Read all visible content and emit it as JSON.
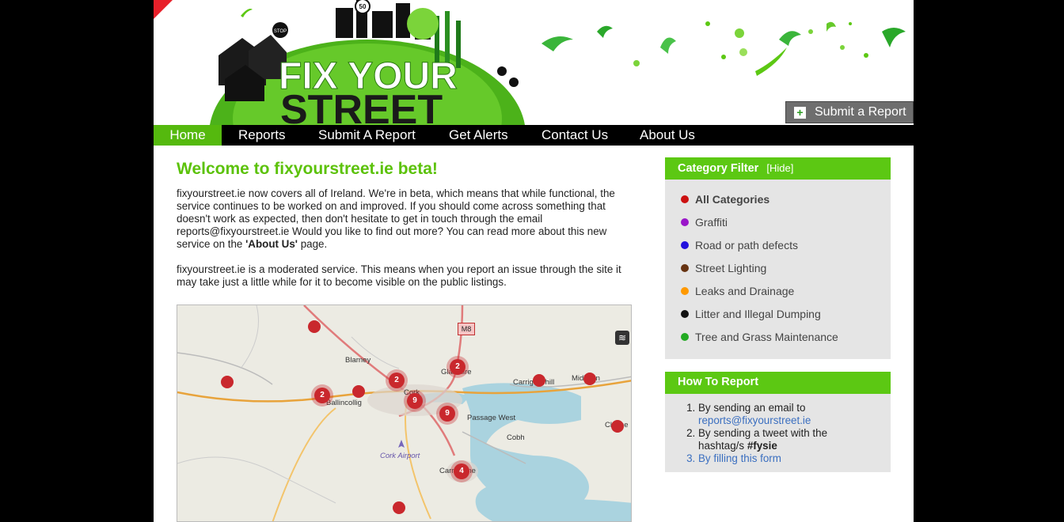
{
  "header": {
    "logo_text_line1": "FIX YOUR",
    "logo_text_line2": "STREET",
    "sign_stop": "STOP",
    "sign_speed": "50",
    "submit_report_label": "Submit a Report"
  },
  "nav": {
    "items": [
      {
        "label": "Home",
        "active": true
      },
      {
        "label": "Reports"
      },
      {
        "label": "Submit A Report"
      },
      {
        "label": "Get Alerts"
      },
      {
        "label": "Contact Us"
      },
      {
        "label": "About Us"
      }
    ]
  },
  "main": {
    "title": "Welcome to fixyourstreet.ie beta!",
    "p1_text": "fixyourstreet.ie now covers all of Ireland. We're in beta, which means that while functional, the service continues to be worked on and improved. If you should come across something that doesn't work as expected, then don't hesitate to get in touch through the email reports@fixyourstreet.ie Would you like to find out more? You can read more about this new service on the",
    "p1_bold": "'About Us'",
    "p1_end": " page.",
    "p2_text": "fixyourstreet.ie is a moderated service. This means when you report an issue through the site it may take just a little while for it to become visible on the public listings."
  },
  "map": {
    "road_sign": "M8",
    "labels": [
      "Blarney",
      "Glanmire",
      "Carrigtwohill",
      "Midleton",
      "Cork",
      "Ballincollig",
      "Passage West",
      "Cobh",
      "Cloyne",
      "Cork Airport",
      "Carrigaline"
    ],
    "clusters": [
      "2",
      "2",
      "2",
      "9",
      "9",
      "4"
    ],
    "layers_icon": "layers-icon"
  },
  "category_filter": {
    "title": "Category Filter",
    "hide_label": "[Hide]",
    "items": [
      {
        "label": "All Categories",
        "color": "#cc1111"
      },
      {
        "label": "Graffiti",
        "color": "#9a16c9"
      },
      {
        "label": "Road or path defects",
        "color": "#2211dd"
      },
      {
        "label": "Street Lighting",
        "color": "#663311"
      },
      {
        "label": "Leaks and Drainage",
        "color": "#ff9900"
      },
      {
        "label": "Litter and Illegal Dumping",
        "color": "#111111"
      },
      {
        "label": "Tree and Grass Maintenance",
        "color": "#22aa22"
      }
    ]
  },
  "how_to": {
    "title": "How To Report",
    "step1_text": "By sending an email to",
    "step1_link": "reports@fixyourstreet.ie",
    "step2_text": "By sending a tweet with the hashtag/s",
    "step2_tag": "#fysie",
    "step3_link": "By filling this form"
  },
  "colors": {
    "brand_green": "#5cc813",
    "nav_black": "#000000",
    "marker_red": "#c9282d"
  }
}
